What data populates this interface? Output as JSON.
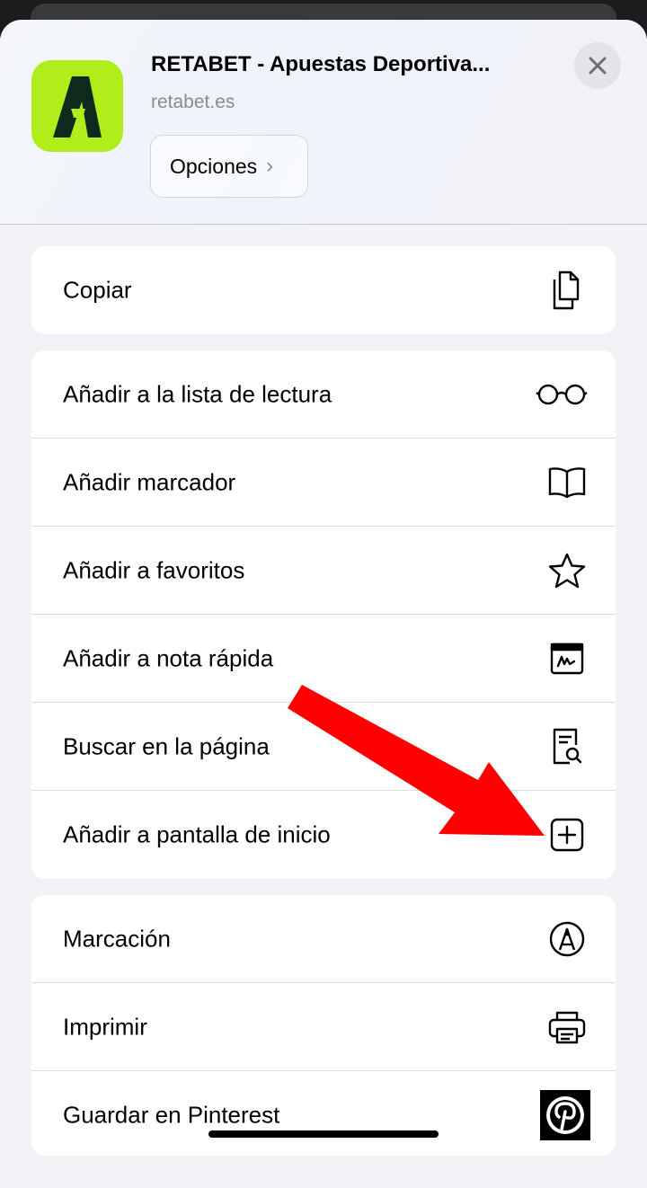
{
  "header": {
    "site_title": "RETABET - Apuestas Deportiva...",
    "site_url": "retabet.es",
    "options_label": "Opciones"
  },
  "groups": [
    {
      "items": [
        {
          "label": "Copiar",
          "icon": "copy-icon"
        }
      ]
    },
    {
      "items": [
        {
          "label": "Añadir a la lista de lectura",
          "icon": "glasses-icon"
        },
        {
          "label": "Añadir marcador",
          "icon": "book-icon"
        },
        {
          "label": "Añadir a favoritos",
          "icon": "star-icon"
        },
        {
          "label": "Añadir a nota rápida",
          "icon": "quick-note-icon"
        },
        {
          "label": "Buscar en la página",
          "icon": "find-in-page-icon"
        },
        {
          "label": "Añadir a pantalla de inicio",
          "icon": "add-square-icon"
        }
      ]
    },
    {
      "items": [
        {
          "label": "Marcación",
          "icon": "markup-icon"
        },
        {
          "label": "Imprimir",
          "icon": "printer-icon"
        },
        {
          "label": "Guardar en Pinterest",
          "icon": "pinterest-icon"
        }
      ]
    }
  ],
  "colors": {
    "app_icon_bg": "#b2ec1b",
    "arrow": "#ff0000"
  }
}
